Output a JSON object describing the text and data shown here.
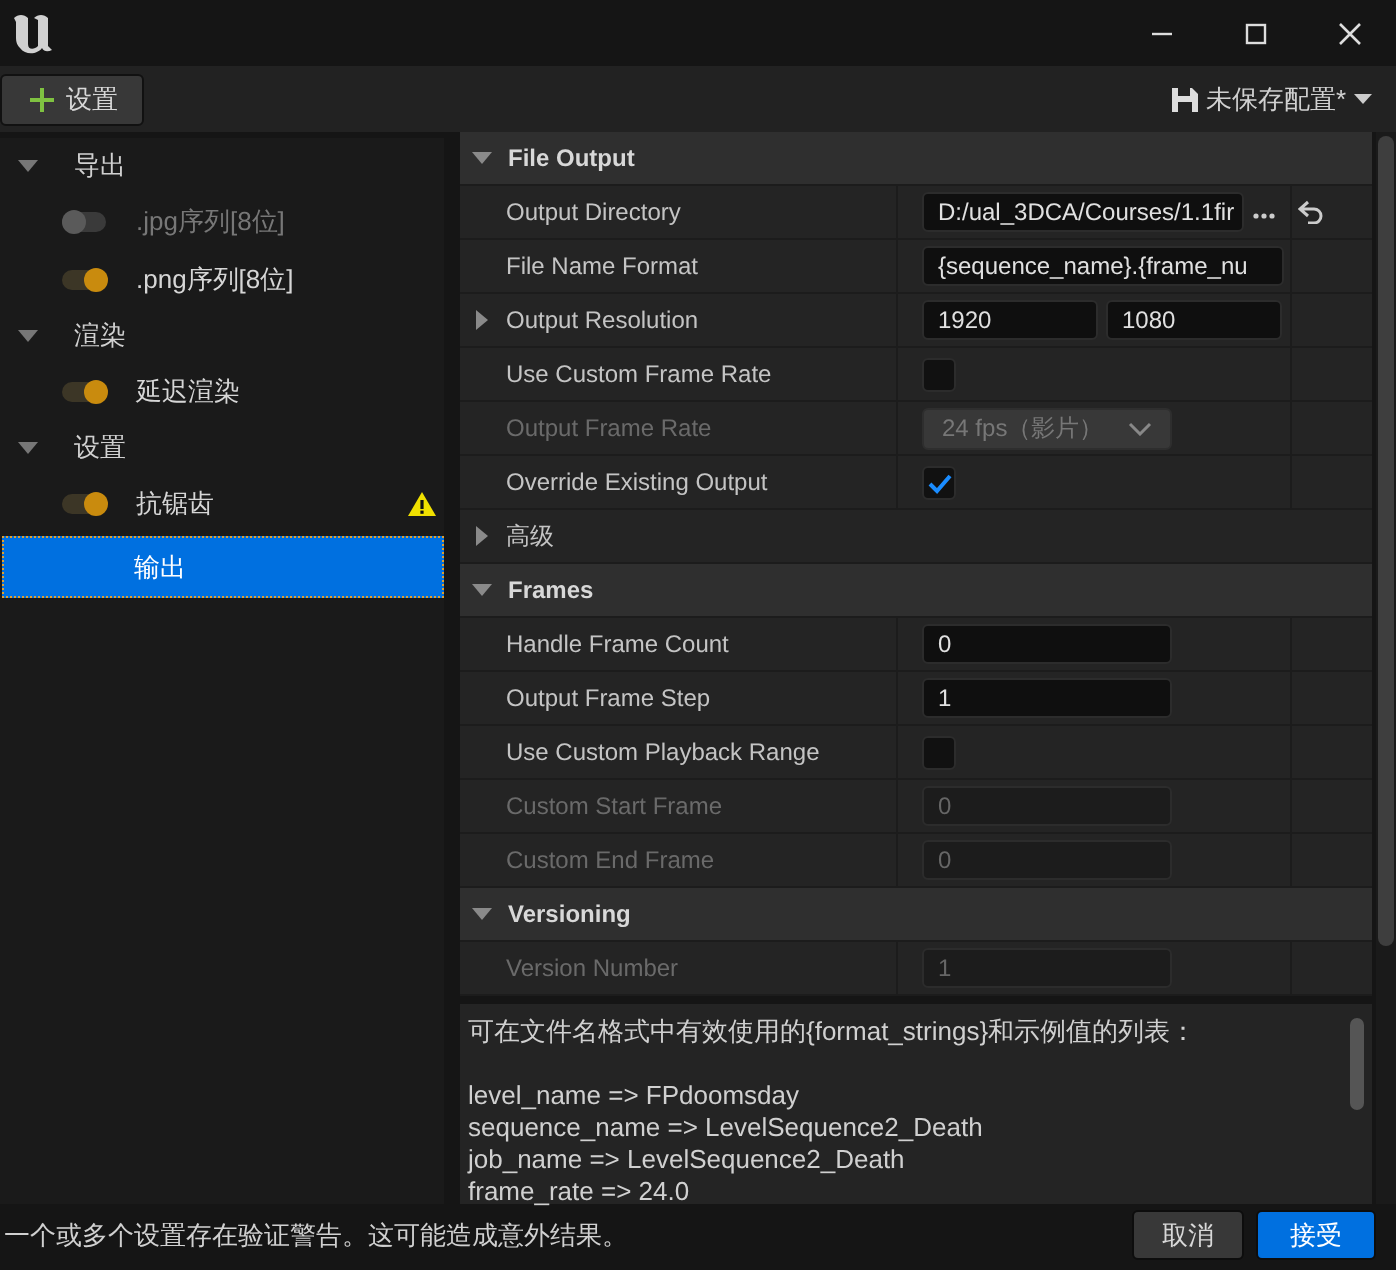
{
  "toolbar": {
    "add_button": "设置",
    "preset_menu": "未保存配置*"
  },
  "sidebar": {
    "groups": [
      {
        "label": "导出",
        "expanded": true,
        "children": [
          {
            "kind": "toggle",
            "label": ".jpg序列[8位]",
            "on": false,
            "warning": false,
            "selected": false
          },
          {
            "kind": "toggle",
            "label": ".png序列[8位]",
            "on": true,
            "warning": false,
            "selected": false
          }
        ]
      },
      {
        "label": "渲染",
        "expanded": true,
        "children": [
          {
            "kind": "toggle",
            "label": "延迟渲染",
            "on": true,
            "warning": false,
            "selected": false
          }
        ]
      },
      {
        "label": "设置",
        "expanded": true,
        "children": [
          {
            "kind": "toggle",
            "label": "抗锯齿",
            "on": true,
            "warning": true,
            "selected": false
          },
          {
            "kind": "plain",
            "label": "输出",
            "selected": true
          }
        ]
      }
    ]
  },
  "properties": {
    "sections": [
      {
        "title": "File Output",
        "expanded": true,
        "rows": [
          {
            "kind": "path",
            "label": "Output Directory",
            "value": "D:/ual_3DCA/Courses/1.1fir",
            "disabled": false,
            "reset": true
          },
          {
            "kind": "text",
            "label": "File Name Format",
            "value": "{sequence_name}.{frame_nu",
            "disabled": false
          },
          {
            "kind": "pair",
            "label": "Output Resolution",
            "values": [
              "1920",
              "1080"
            ],
            "expanded": false,
            "disabled": false
          },
          {
            "kind": "checkbox",
            "label": "Use Custom Frame Rate",
            "checked": false,
            "disabled": false
          },
          {
            "kind": "dropdown",
            "label": "Output Frame Rate",
            "value": "24 fps（影片）",
            "disabled": true
          },
          {
            "kind": "checkbox",
            "label": "Override Existing Output",
            "checked": true,
            "disabled": false
          },
          {
            "kind": "group",
            "label": "高级",
            "expanded": false
          }
        ]
      },
      {
        "title": "Frames",
        "expanded": true,
        "rows": [
          {
            "kind": "text",
            "label": "Handle Frame Count",
            "value": "0",
            "disabled": false
          },
          {
            "kind": "text",
            "label": "Output Frame Step",
            "value": "1",
            "disabled": false
          },
          {
            "kind": "checkbox",
            "label": "Use Custom Playback Range",
            "checked": false,
            "disabled": false
          },
          {
            "kind": "text",
            "label": "Custom Start Frame",
            "value": "0",
            "disabled": true
          },
          {
            "kind": "text",
            "label": "Custom End Frame",
            "value": "0",
            "disabled": true
          }
        ]
      },
      {
        "title": "Versioning",
        "expanded": true,
        "rows": [
          {
            "kind": "text",
            "label": "Version Number",
            "value": "1",
            "disabled": true
          }
        ]
      }
    ]
  },
  "description": {
    "intro": "可在文件名格式中有效使用的{format_strings}和示例值的列表：",
    "lines": [
      "level_name => FPdoomsday",
      "sequence_name => LevelSequence2_Death",
      "job_name => LevelSequence2_Death",
      "frame_rate => 24.0"
    ]
  },
  "status_bar": {
    "message": "一个或多个设置存在验证警告。这可能造成意外结果。",
    "buttons": [
      {
        "label": "取消",
        "primary": false
      },
      {
        "label": "接受",
        "primary": true
      }
    ]
  }
}
